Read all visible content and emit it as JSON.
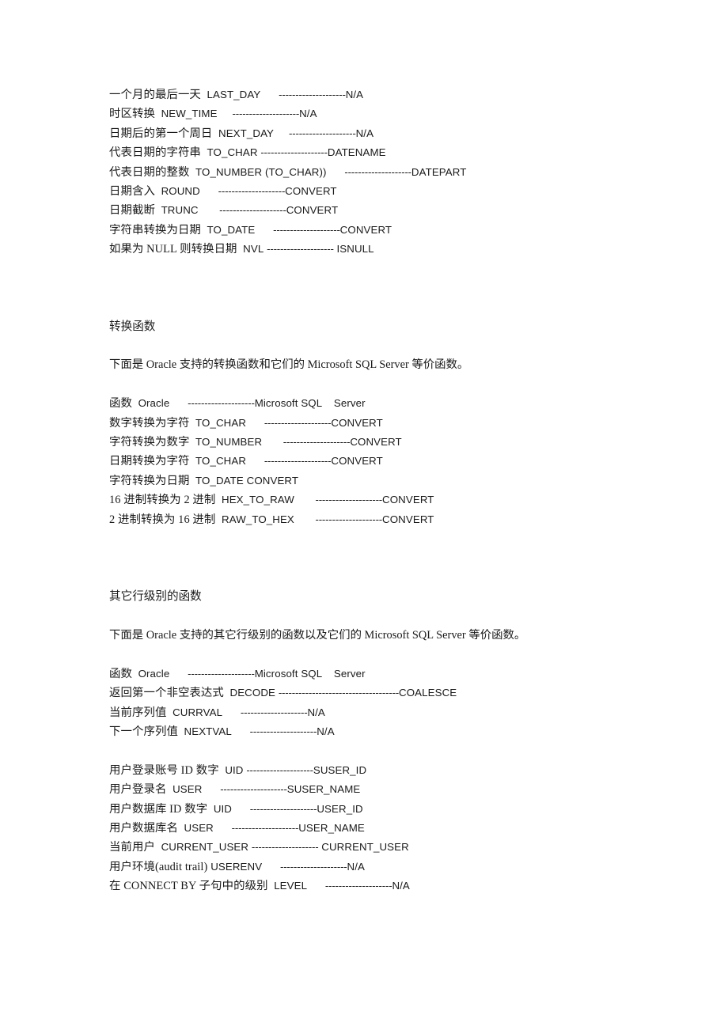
{
  "document": {
    "page_background": "#ffffff",
    "text_color": "#1a1a1a",
    "sections": [
      {
        "id": "date-functions-tail",
        "rows": [
          {
            "label": "一个月的最后一天",
            "oracle": "LAST_DAY",
            "sep": "--------------------",
            "mssql": "N/A"
          },
          {
            "label": "时区转换",
            "oracle": "NEW_TIME",
            "sep": "--------------------",
            "mssql": "N/A"
          },
          {
            "label": "日期后的第一个周日",
            "oracle": "NEXT_DAY",
            "sep": "--------------------",
            "mssql": "N/A"
          },
          {
            "label": "代表日期的字符串",
            "oracle": "TO_CHAR",
            "sep": "--------------------",
            "mssql": "DATENAME"
          },
          {
            "label": "代表日期的整数",
            "oracle": "TO_NUMBER (TO_CHAR))",
            "sep": "--------------------",
            "mssql": "DATEPART"
          },
          {
            "label": "日期含入",
            "oracle": "ROUND",
            "sep": "--------------------",
            "mssql": "CONVERT"
          },
          {
            "label": "日期截断",
            "oracle": "TRUNC",
            "sep": "--------------------",
            "mssql": "CONVERT"
          },
          {
            "label": "字符串转换为日期",
            "oracle": "TO_DATE",
            "sep": "--------------------",
            "mssql": "CONVERT"
          },
          {
            "label": "如果为 NULL 则转换日期",
            "oracle": "NVL",
            "sep": "--------------------",
            "mssql": " ISNULL"
          }
        ]
      },
      {
        "id": "conversion-functions",
        "heading": "转换函数",
        "intro": "下面是 Oracle 支持的转换函数和它们的 Microsoft SQL Server 等价函数。",
        "table_header": {
          "label": "函数",
          "oracle": "Oracle",
          "sep": "--------------------",
          "mssql": "Microsoft SQL    Server"
        },
        "rows": [
          {
            "label": "数字转换为字符",
            "oracle": "TO_CHAR",
            "sep": "--------------------",
            "mssql": "CONVERT"
          },
          {
            "label": "字符转换为数字",
            "oracle": "TO_NUMBER",
            "sep": "--------------------",
            "mssql": "CONVERT"
          },
          {
            "label": "日期转换为字符",
            "oracle": "TO_CHAR",
            "sep": "--------------------",
            "mssql": "CONVERT"
          },
          {
            "label": "字符转换为日期",
            "oracle": "TO_DATE CONVERT",
            "sep": "",
            "mssql": ""
          },
          {
            "label": "16 进制转换为 2 进制",
            "oracle": "HEX_TO_RAW",
            "sep": "--------------------",
            "mssql": "CONVERT"
          },
          {
            "label": "2 进制转换为 16 进制",
            "oracle": "RAW_TO_HEX",
            "sep": "--------------------",
            "mssql": "CONVERT"
          }
        ]
      },
      {
        "id": "other-row-level-functions",
        "heading": "其它行级别的函数",
        "intro": "下面是 Oracle 支持的其它行级别的函数以及它们的 Microsoft SQL Server 等价函数。",
        "table_header": {
          "label": "函数",
          "oracle": "Oracle",
          "sep": "--------------------",
          "mssql": "Microsoft SQL    Server"
        },
        "rows": [
          {
            "label": "返回第一个非空表达式",
            "oracle": "DECODE",
            "sep": "------------------------------------",
            "mssql": "COALESCE"
          },
          {
            "label": "当前序列值",
            "oracle": "CURRVAL",
            "sep": "--------------------",
            "mssql": "N/A"
          },
          {
            "label": "下一个序列值",
            "oracle": "NEXTVAL",
            "sep": "--------------------",
            "mssql": "N/A"
          }
        ],
        "rows_group_two": [
          {
            "label": "用户登录账号 ID 数字",
            "oracle": "UID",
            "sep": "--------------------",
            "mssql": "SUSER_ID"
          },
          {
            "label": "用户登录名",
            "oracle": "USER",
            "sep": "--------------------",
            "mssql": "SUSER_NAME"
          },
          {
            "label": "用户数据库 ID 数字",
            "oracle": "UID",
            "sep": "--------------------",
            "mssql": "USER_ID"
          },
          {
            "label": "用户数据库名",
            "oracle": "USER",
            "sep": "--------------------",
            "mssql": "USER_NAME"
          },
          {
            "label": "当前用户",
            "oracle": "CURRENT_USER",
            "sep": "--------------------",
            "mssql": " CURRENT_USER"
          },
          {
            "label": "用户环境(audit trail)",
            "oracle": "USERENV",
            "sep": "--------------------",
            "mssql": "N/A"
          },
          {
            "label": "在 CONNECT BY 子句中的级别",
            "oracle": "LEVEL",
            "sep": "--------------------",
            "mssql": "N/A"
          }
        ]
      }
    ]
  }
}
